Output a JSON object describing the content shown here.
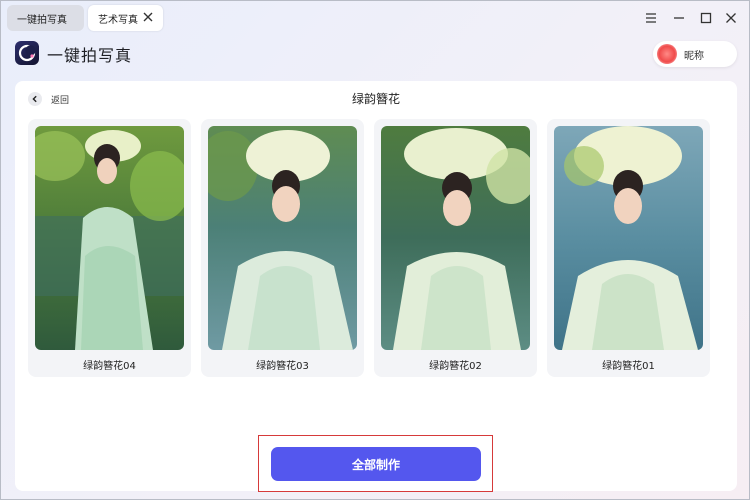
{
  "tabs": [
    {
      "label": "一键拍写真",
      "active": false
    },
    {
      "label": "艺术写真",
      "active": true
    }
  ],
  "window_controls": [
    "menu-icon",
    "minimize-icon",
    "maximize-icon",
    "close-icon"
  ],
  "header": {
    "app_title": "一键拍写真",
    "user": {
      "nickname": "昵称"
    }
  },
  "page": {
    "back_label": "返回",
    "title": "绿韵簪花"
  },
  "cards": [
    {
      "label": "绿韵簪花04"
    },
    {
      "label": "绿韵簪花03"
    },
    {
      "label": "绿韵簪花02"
    },
    {
      "label": "绿韵簪花01"
    }
  ],
  "action": {
    "make_all_label": "全部制作"
  },
  "colors": {
    "accent": "#5457ee",
    "highlight": "#d63a3a",
    "panel": "#ffffff",
    "card": "#f3f4f7"
  }
}
